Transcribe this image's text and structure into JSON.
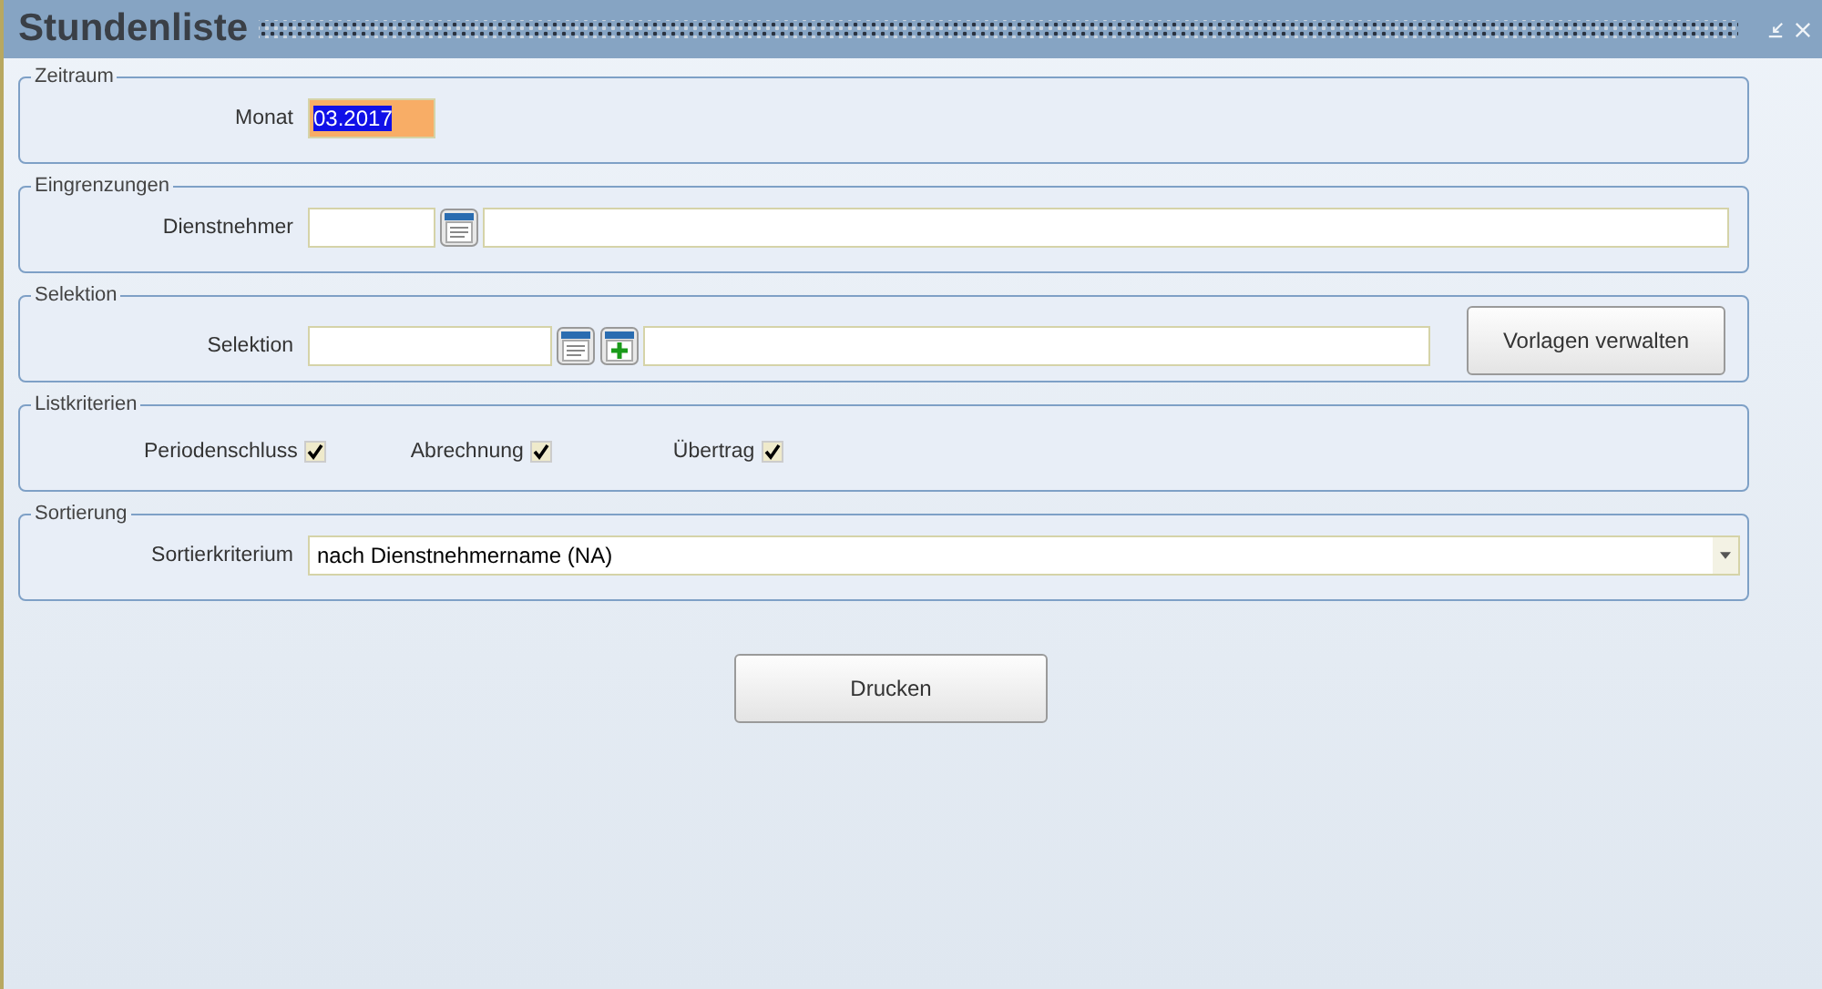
{
  "window": {
    "title": "Stundenliste"
  },
  "zeitraum": {
    "legend": "Zeitraum",
    "label": "Monat",
    "value": "03.2017",
    "text_selected": true
  },
  "eingrenzungen": {
    "legend": "Eingrenzungen",
    "label": "Dienstnehmer"
  },
  "selektion": {
    "legend": "Selektion",
    "label": "Selektion",
    "button": "Vorlagen verwalten"
  },
  "listkriterien": {
    "legend": "Listkriterien",
    "options": [
      {
        "label": "Periodenschluss",
        "checked": true
      },
      {
        "label": "Abrechnung",
        "checked": true
      },
      {
        "label": "Übertrag",
        "checked": true
      }
    ]
  },
  "sortierung": {
    "legend": "Sortierung",
    "label": "Sortierkriterium",
    "value": "nach Dienstnehmername (NA)"
  },
  "print_button": "Drucken"
}
